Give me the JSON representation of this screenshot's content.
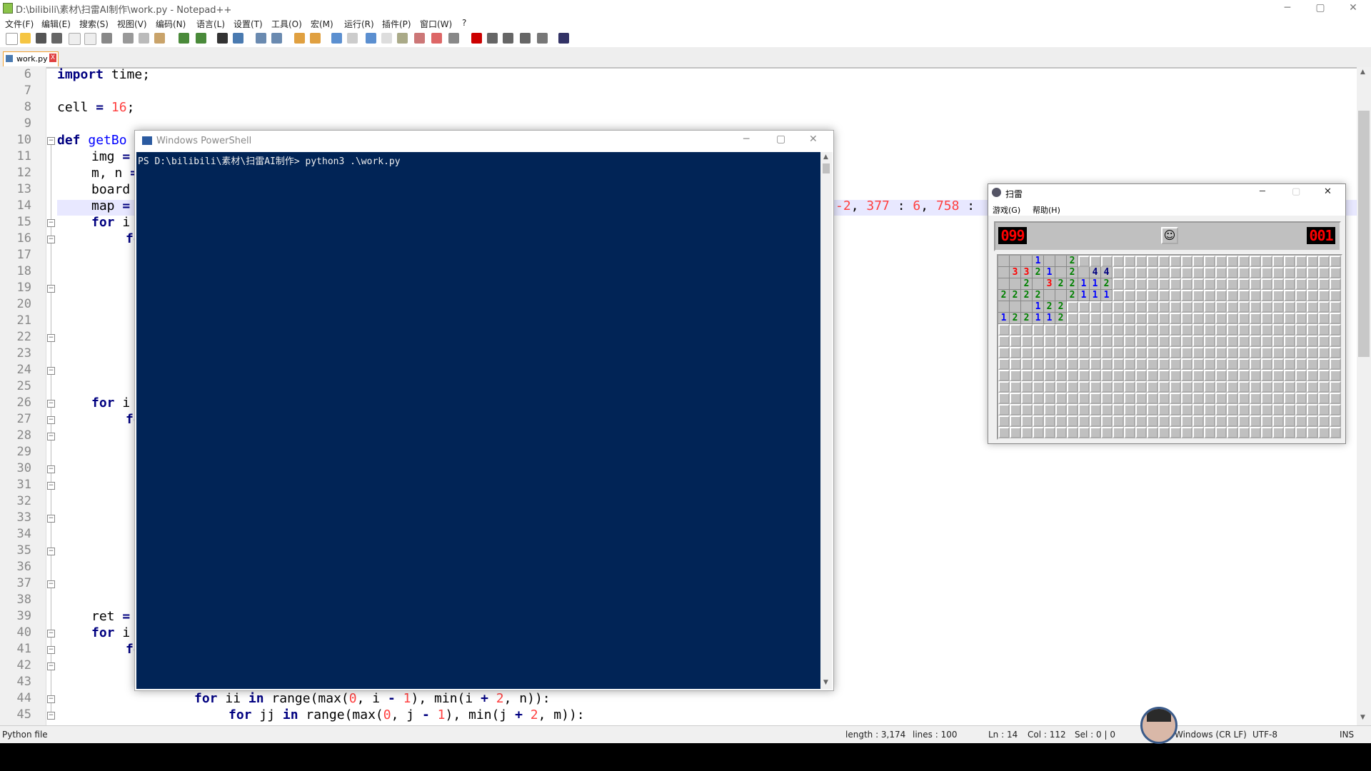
{
  "app": {
    "title": "D:\\bilibili\\素材\\扫雷AI制作\\work.py - Notepad++",
    "menu": [
      "文件(F)",
      "编辑(E)",
      "搜索(S)",
      "视图(V)",
      "编码(N)",
      "语言(L)",
      "设置(T)",
      "工具(O)",
      "宏(M)",
      "运行(R)",
      "插件(P)",
      "窗口(W)",
      "?"
    ],
    "tab_label": "work.py",
    "close_x": "X"
  },
  "editor": {
    "line_numbers": [
      "6",
      "7",
      "8",
      "9",
      "10",
      "11",
      "12",
      "13",
      "14",
      "15",
      "16",
      "17",
      "18",
      "19",
      "20",
      "21",
      "22",
      "23",
      "24",
      "25",
      "26",
      "27",
      "28",
      "29",
      "30",
      "31",
      "32",
      "33",
      "34",
      "35",
      "36",
      "37",
      "38",
      "39",
      "40",
      "41",
      "42",
      "43",
      "44",
      "45"
    ],
    "fold_lines": [
      "10",
      "15",
      "16",
      "19",
      "22",
      "24",
      "26",
      "27",
      "28",
      "30",
      "31",
      "33",
      "35",
      "37",
      "40",
      "41",
      "42",
      "44",
      "45"
    ],
    "visible_code": {
      "l6": "import time;",
      "l8": "cell = 16;",
      "l10": "def getBo",
      "l11": "img =",
      "l12": "m, n =",
      "l13": "board",
      "l14": "map =",
      "l14_tail": "-2, 377 : 6, 758 :",
      "l15": "for i",
      "l16": "fo",
      "l26": "for i",
      "l27": "fo",
      "l39": "ret =",
      "l40": "for i",
      "l41": "fo",
      "l44": "for ii in range(max(0, i - 1), min(i + 2, n)):",
      "l45": "for jj in range(max(0, j - 1), min(j + 2, m)):"
    }
  },
  "status": {
    "filetype": "Python file",
    "length": "length : 3,174",
    "lines": "lines : 100",
    "ln": "Ln : 14",
    "col": "Col : 112",
    "sel": "Sel : 0 | 0",
    "eol": "Windows (CR LF)",
    "encoding": "UTF-8",
    "mode": "INS"
  },
  "powershell": {
    "title": "Windows PowerShell",
    "prompt_line": "PS D:\\bilibili\\素材\\扫雷AI制作> python3 .\\work.py"
  },
  "minesweeper": {
    "title": "扫雷",
    "menu_game": "游戏(G)",
    "menu_help": "帮助(H)",
    "mines_left": "099",
    "timer": "001",
    "face": "☺",
    "cols": 30,
    "rows": 16,
    "revealed": [
      [
        null,
        null,
        null,
        "1",
        null,
        null,
        "2",
        "c",
        "c",
        "c"
      ],
      [
        null,
        "3",
        "3",
        "2",
        "1",
        null,
        "2",
        null,
        "4",
        "4"
      ],
      [
        null,
        null,
        "2",
        null,
        "3",
        "2",
        "2",
        "1",
        "1",
        "2"
      ],
      [
        "2",
        "2",
        "2",
        "2",
        null,
        null,
        "2",
        "1",
        "1",
        "1"
      ],
      [
        null,
        null,
        null,
        "1",
        "2",
        "2",
        "c",
        "c",
        "c",
        "c"
      ],
      [
        "1",
        "2",
        "2",
        "1",
        "1",
        "2",
        "c",
        "c",
        "c",
        "c"
      ]
    ],
    "colors": {
      "1": "#0000ff",
      "2": "#008000",
      "3": "#ff0000",
      "4": "#000080"
    }
  }
}
